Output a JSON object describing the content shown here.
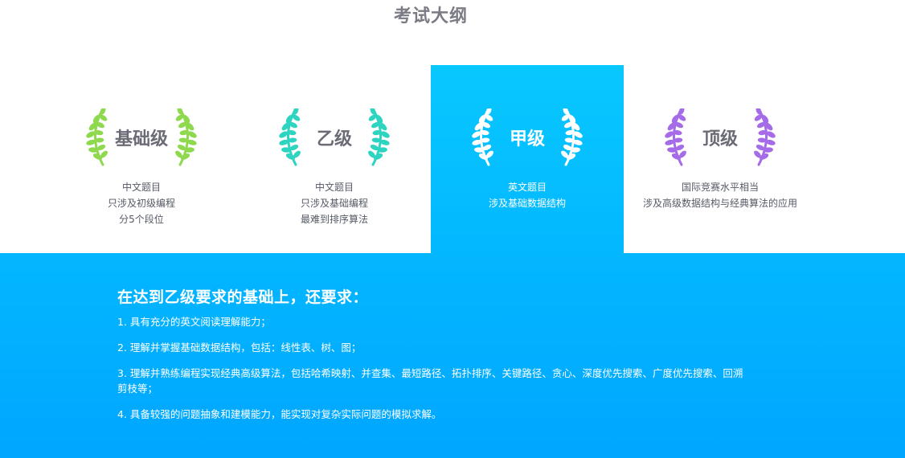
{
  "page": {
    "title": "考试大纲"
  },
  "levels": [
    {
      "name": "基础级",
      "laurel_color": "#8fd94e",
      "desc": [
        "中文题目",
        "只涉及初级编程",
        "分5个段位"
      ]
    },
    {
      "name": "乙级",
      "laurel_color": "#2dd4c0",
      "desc": [
        "中文题目",
        "只涉及基础编程",
        "最难到排序算法"
      ]
    },
    {
      "name": "甲级",
      "laurel_color": "#ffffff",
      "desc": [
        "英文题目",
        "涉及基础数据结构"
      ]
    },
    {
      "name": "顶级",
      "laurel_color": "#a56be8",
      "desc": [
        "国际竞赛水平相当",
        "涉及高级数据结构与经典算法的应用"
      ]
    }
  ],
  "active_level_index": 2,
  "requirements": {
    "heading": "在达到乙级要求的基础上，还要求：",
    "items": [
      "1. 具有充分的英文阅读理解能力；",
      "2. 理解并掌握基础数据结构，包括：线性表、树、图；",
      "3. 理解并熟练编程实现经典高级算法，包括哈希映射、并查集、最短路径、拓扑排序、关键路径、贪心、深度优先搜索、广度优先搜索、回溯剪枝等；",
      "4. 具备较强的问题抽象和建模能力，能实现对复杂实际问题的模拟求解。"
    ]
  },
  "colors": {
    "accent": "#03b7ff",
    "title_gray": "#7b7b85",
    "text_gray": "#555a66"
  }
}
